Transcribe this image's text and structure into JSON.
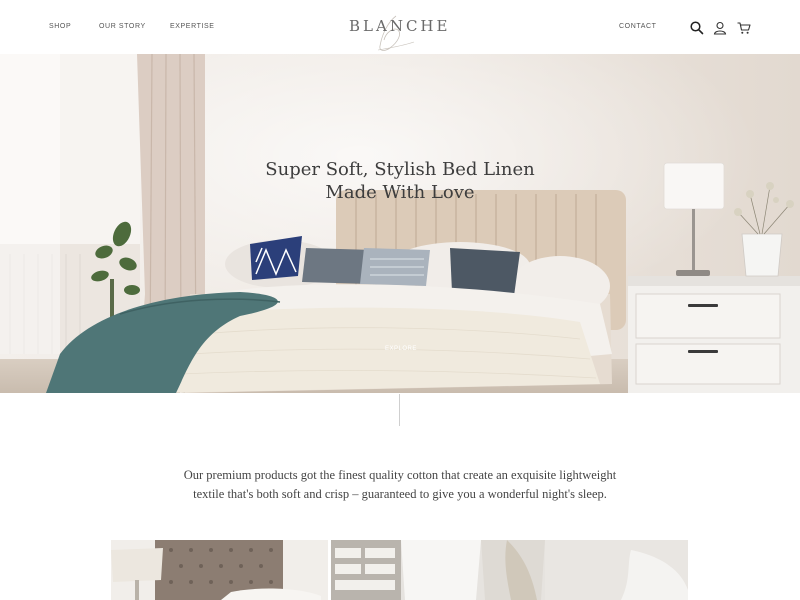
{
  "header": {
    "nav_left": [
      "SHOP",
      "OUR STORY",
      "EXPERTISE"
    ],
    "logo": "BLANCHE",
    "nav_right": [
      "CONTACT"
    ],
    "icons": [
      "search-icon",
      "user-icon",
      "cart-icon"
    ]
  },
  "hero": {
    "title_line1": "Super Soft, Stylish Bed Linen",
    "title_line2": "Made With Love",
    "cta_label": "EXPLORE"
  },
  "intro": {
    "line1": "Our premium products got the finest quality cotton that create an exquisite lightweight",
    "line2": "textile that's both soft and crisp – guaranteed to give you a wonderful night's sleep."
  },
  "colors": {
    "background": "#ffffff",
    "text": "#3d3d3d",
    "teal_throw": "#4f7677",
    "headboard": "#dccbb8",
    "navy_pillow": "#2b3f7a"
  }
}
